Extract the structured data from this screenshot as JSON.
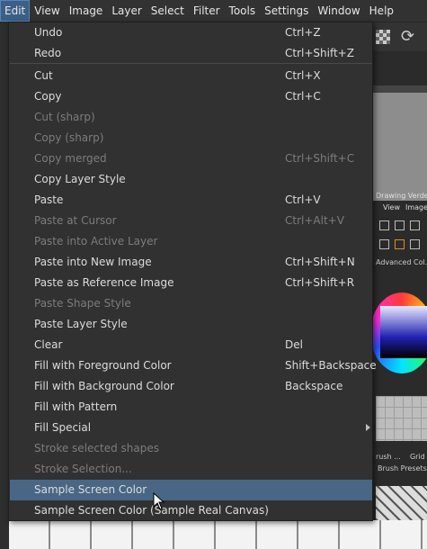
{
  "menubar": {
    "items": [
      "Edit",
      "View",
      "Image",
      "Layer",
      "Select",
      "Filter",
      "Tools",
      "Settings",
      "Window",
      "Help"
    ]
  },
  "docker": {
    "title": "Drawing Verde D",
    "tab_view": "View",
    "tab_image": "Image",
    "advanced_color": "Advanced Col...",
    "brush_tab": "rush ...",
    "grid_tab": "Grid",
    "brush_presets": "Brush Presets"
  },
  "edit_menu": {
    "items": [
      {
        "label": "Undo",
        "shortcut": "Ctrl+Z",
        "enabled": true
      },
      {
        "label": "Redo",
        "shortcut": "Ctrl+Shift+Z",
        "enabled": true
      },
      {
        "label": "Cut",
        "shortcut": "Ctrl+X",
        "enabled": true
      },
      {
        "label": "Copy",
        "shortcut": "Ctrl+C",
        "enabled": true
      },
      {
        "label": "Cut (sharp)",
        "shortcut": "",
        "enabled": false
      },
      {
        "label": "Copy (sharp)",
        "shortcut": "",
        "enabled": false
      },
      {
        "label": "Copy merged",
        "shortcut": "Ctrl+Shift+C",
        "enabled": false
      },
      {
        "label": "Copy Layer Style",
        "shortcut": "",
        "enabled": true
      },
      {
        "label": "Paste",
        "shortcut": "Ctrl+V",
        "enabled": true
      },
      {
        "label": "Paste at Cursor",
        "shortcut": "Ctrl+Alt+V",
        "enabled": false
      },
      {
        "label": "Paste into Active Layer",
        "shortcut": "",
        "enabled": false
      },
      {
        "label": "Paste into New Image",
        "shortcut": "Ctrl+Shift+N",
        "enabled": true
      },
      {
        "label": "Paste as Reference Image",
        "shortcut": "Ctrl+Shift+R",
        "enabled": true
      },
      {
        "label": "Paste Shape Style",
        "shortcut": "",
        "enabled": false
      },
      {
        "label": "Paste Layer Style",
        "shortcut": "",
        "enabled": true
      },
      {
        "label": "Clear",
        "shortcut": "Del",
        "enabled": true
      },
      {
        "label": "Fill with Foreground Color",
        "shortcut": "Shift+Backspace",
        "enabled": true
      },
      {
        "label": "Fill with Background Color",
        "shortcut": "Backspace",
        "enabled": true
      },
      {
        "label": "Fill with Pattern",
        "shortcut": "",
        "enabled": true
      },
      {
        "label": "Fill Special",
        "shortcut": "",
        "enabled": true,
        "submenu": true
      },
      {
        "label": "Stroke selected shapes",
        "shortcut": "",
        "enabled": false
      },
      {
        "label": "Stroke Selection...",
        "shortcut": "",
        "enabled": false
      },
      {
        "label": "Sample Screen Color",
        "shortcut": "",
        "enabled": true,
        "highlighted": true
      },
      {
        "label": "Sample Screen Color (Sample Real Canvas)",
        "shortcut": "",
        "enabled": true
      }
    ]
  },
  "colors": {
    "menu_background": "#313131",
    "highlight": "#496684",
    "disabled_text": "#7c7c7c",
    "text": "#dcdcdc"
  }
}
